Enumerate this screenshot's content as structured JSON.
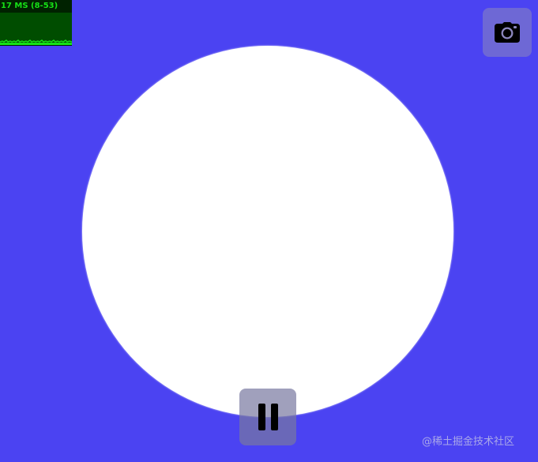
{
  "stats": {
    "readout": "17 MS (8-53)",
    "text_color": "#16e116",
    "background_color": "#002200"
  },
  "scene": {
    "background_color": "#4b43f2",
    "shape": "circle",
    "shape_color": "#ffffff"
  },
  "controls": {
    "screenshot_icon": "camera-icon",
    "pause_icon": "pause-icon"
  },
  "watermark": {
    "text": "@稀土掘金技术社区"
  }
}
